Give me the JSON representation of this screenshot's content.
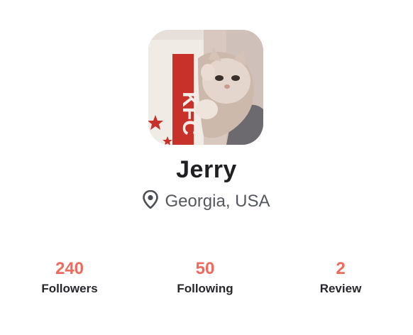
{
  "profile": {
    "name": "Jerry",
    "location": "Georgia, USA",
    "location_icon": "map-pin-icon",
    "avatar_description": "cat-photo"
  },
  "stats": [
    {
      "value": "240",
      "label": "Followers"
    },
    {
      "value": "50",
      "label": "Following"
    },
    {
      "value": "2",
      "label": "Review"
    }
  ],
  "colors": {
    "accent": "#ee6a5c",
    "name_text": "#1f1f24",
    "location_text": "#555860",
    "label_text": "#26272c"
  }
}
